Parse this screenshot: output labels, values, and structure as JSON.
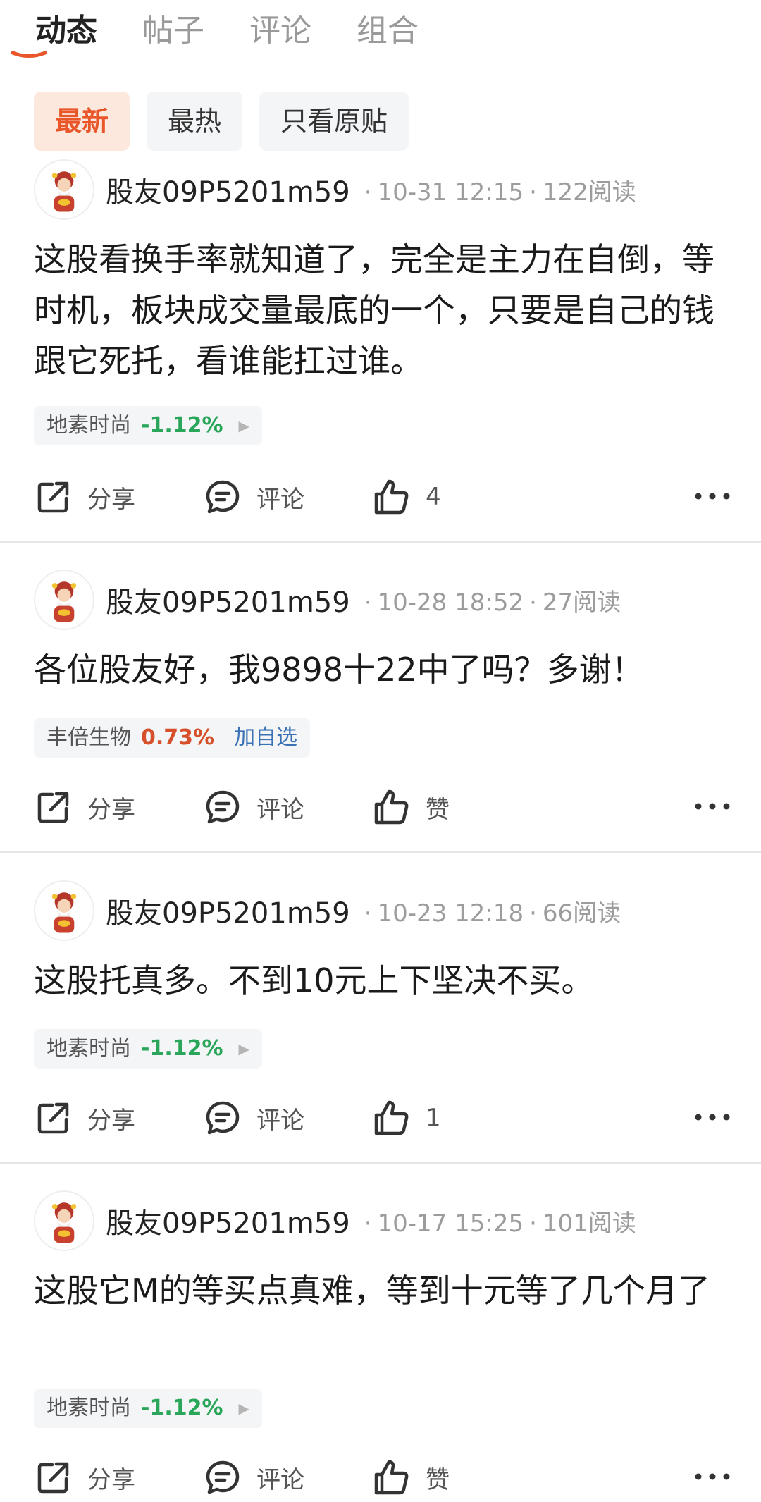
{
  "tabs": [
    {
      "label": "动态",
      "active": true
    },
    {
      "label": "帖子",
      "active": false
    },
    {
      "label": "评论",
      "active": false
    },
    {
      "label": "组合",
      "active": false
    }
  ],
  "filters": [
    {
      "label": "最新",
      "active": true
    },
    {
      "label": "最热",
      "active": false
    },
    {
      "label": "只看原贴",
      "active": false
    }
  ],
  "colors": {
    "accent": "#e8562a",
    "down": "#2aa65a",
    "up": "#d6512b",
    "link": "#3a72b5"
  },
  "posts": [
    {
      "username": "股友09P5201m59",
      "date": "10-31 12:15",
      "reads": "122阅读",
      "text": "这股看换手率就知道了，完全是主力在自倒，等时机，板块成交量最底的一个，只要是自己的钱跟它死托，看谁能扛过谁。",
      "stock": {
        "name": "地素时尚",
        "change": "-1.12%",
        "direction": "down",
        "extra": ""
      },
      "actions": {
        "share": "分享",
        "comment": "评论",
        "like": "4"
      }
    },
    {
      "username": "股友09P5201m59",
      "date": "10-28 18:52",
      "reads": "27阅读",
      "text": "各位股友好，我9898十22中了吗？多谢！",
      "stock": {
        "name": "丰倍生物",
        "change": "0.73%",
        "direction": "up",
        "extra": "加自选"
      },
      "actions": {
        "share": "分享",
        "comment": "评论",
        "like": "赞"
      }
    },
    {
      "username": "股友09P5201m59",
      "date": "10-23 12:18",
      "reads": "66阅读",
      "text": "这股托真多。不到10元上下坚决不买。",
      "stock": {
        "name": "地素时尚",
        "change": "-1.12%",
        "direction": "down",
        "extra": ""
      },
      "actions": {
        "share": "分享",
        "comment": "评论",
        "like": "1"
      }
    },
    {
      "username": "股友09P5201m59",
      "date": "10-17 15:25",
      "reads": "101阅读",
      "text": "这股它M的等买点真难，等到十元等了几个月了",
      "stock": {
        "name": "地素时尚",
        "change": "-1.12%",
        "direction": "down",
        "extra": ""
      },
      "actions": {
        "share": "分享",
        "comment": "评论",
        "like": "赞"
      }
    }
  ],
  "icons": {
    "share": "share-icon",
    "comment": "comment-icon",
    "like": "thumbs-up-icon",
    "more": "more-dots-icon",
    "avatar": "fortune-god-avatar"
  }
}
